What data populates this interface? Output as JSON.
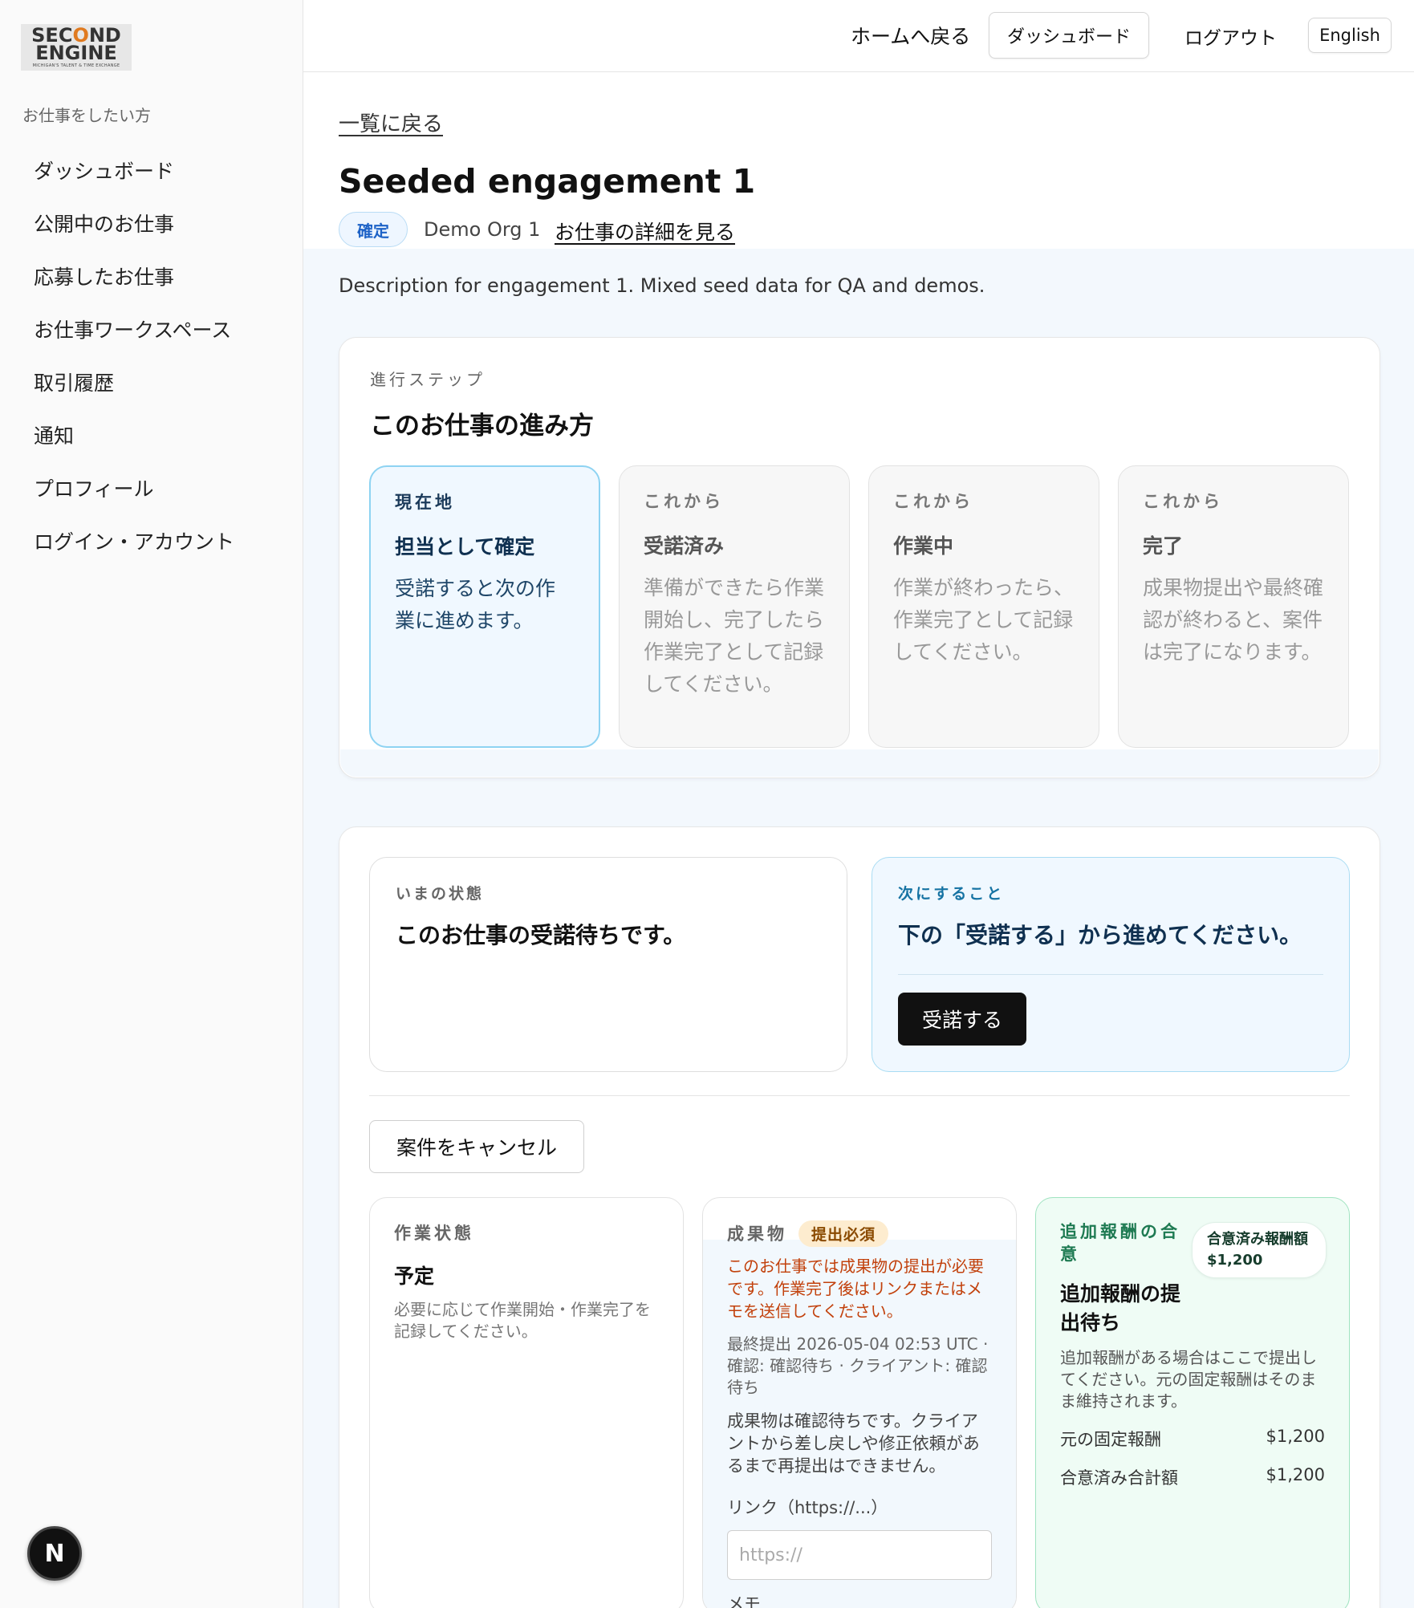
{
  "brand": {
    "logo_line1_pre": "SEC",
    "logo_line1_accent": "O",
    "logo_line1_post": "ND",
    "logo_line2": "ENGINE",
    "logo_tagline": "MICHIGAN'S TALENT & TIME EXCHANGE"
  },
  "sidebar": {
    "heading": "お仕事をしたい方",
    "items": [
      {
        "label": "ダッシュボード"
      },
      {
        "label": "公開中のお仕事"
      },
      {
        "label": "応募したお仕事"
      },
      {
        "label": "お仕事ワークスペース"
      },
      {
        "label": "取引履歴"
      },
      {
        "label": "通知"
      },
      {
        "label": "プロフィール"
      },
      {
        "label": "ログイン・アカウント"
      }
    ],
    "dev_badge": "N"
  },
  "topbar": {
    "home": "ホームへ戻る",
    "dashboard": "ダッシュボード",
    "logout": "ログアウト",
    "language": "English"
  },
  "header": {
    "back": "一覧に戻る",
    "title": "Seeded engagement 1",
    "status": "確定",
    "org": "Demo Org 1",
    "detail_link": "お仕事の詳細を見る",
    "description": "Description for engagement 1. Mixed seed data for QA and demos."
  },
  "progress": {
    "eyebrow": "進行ステップ",
    "title": "このお仕事の進み方",
    "steps": [
      {
        "eyebrow": "現在地",
        "title": "担当として確定",
        "desc": "受諾すると次の作業に進めます。",
        "current": true
      },
      {
        "eyebrow": "これから",
        "title": "受諾済み",
        "desc": "準備ができたら作業開始し、完了したら作業完了として記録してください。",
        "current": false
      },
      {
        "eyebrow": "これから",
        "title": "作業中",
        "desc": "作業が終わったら、作業完了として記録してください。",
        "current": false
      },
      {
        "eyebrow": "これから",
        "title": "完了",
        "desc": "成果物提出や最終確認が終わると、案件は完了になります。",
        "current": false
      }
    ]
  },
  "state": {
    "current_eyebrow": "いまの状態",
    "current_text": "このお仕事の受諾待ちです。",
    "next_eyebrow": "次にすること",
    "next_text": "下の「受諾する」から進めてください。",
    "accept": "受諾する",
    "cancel": "案件をキャンセル"
  },
  "work_status": {
    "eyebrow": "作業状態",
    "value": "予定",
    "note": "必要に応じて作業開始・作業完了を記録してください。"
  },
  "deliverable": {
    "eyebrow": "成果物",
    "required": "提出必須",
    "warning": "このお仕事では成果物の提出が必要です。作業完了後はリンクまたはメモを送信してください。",
    "meta": "最終提出 2026-05-04 02:53 UTC · 確認: 確認待ち · クライアント: 確認待ち",
    "review_note": "成果物は確認待ちです。クライアントから差し戻しや修正依頼があるまで再提出はできません。",
    "link_label": "リンク（https://...）",
    "link_placeholder": "https://",
    "memo_label": "メモ"
  },
  "extra_pay": {
    "eyebrow": "追加報酬の合意",
    "agreed_pill": "合意済み報酬額 $1,200",
    "title": "追加報酬の提出待ち",
    "note": "追加報酬がある場合はここで提出してください。元の固定報酬はそのまま維持されます。",
    "rows": [
      {
        "label": "元の固定報酬",
        "value": "$1,200"
      },
      {
        "label": "合意済み合計額",
        "value": "$1,200"
      }
    ]
  },
  "colors": {
    "accent_blue": "#8ed3f2",
    "required_orange": "#c2410c",
    "pay_green": "#1e7a52",
    "primary_button": "#111111"
  }
}
